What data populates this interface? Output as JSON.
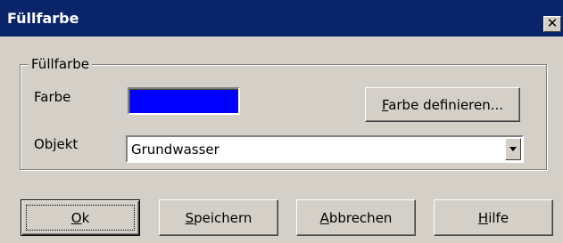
{
  "dialog": {
    "title": "Füllfarbe",
    "close_symbol": "✕"
  },
  "group": {
    "legend": "Füllfarbe",
    "farbe_label": "Farbe",
    "objekt_label": "Objekt",
    "swatch_color": "#0000ff",
    "define_button_accel": "F",
    "define_button_rest": "arbe definieren...",
    "objekt_value": "Grundwasser"
  },
  "buttons": {
    "ok_accel": "O",
    "ok_rest": "k",
    "save_accel": "S",
    "save_rest": "peichern",
    "cancel_accel": "A",
    "cancel_rest": "bbrechen",
    "help_accel": "H",
    "help_rest": "ilfe"
  },
  "icons": {
    "close": "close-icon",
    "dropdown": "chevron-down-icon"
  }
}
